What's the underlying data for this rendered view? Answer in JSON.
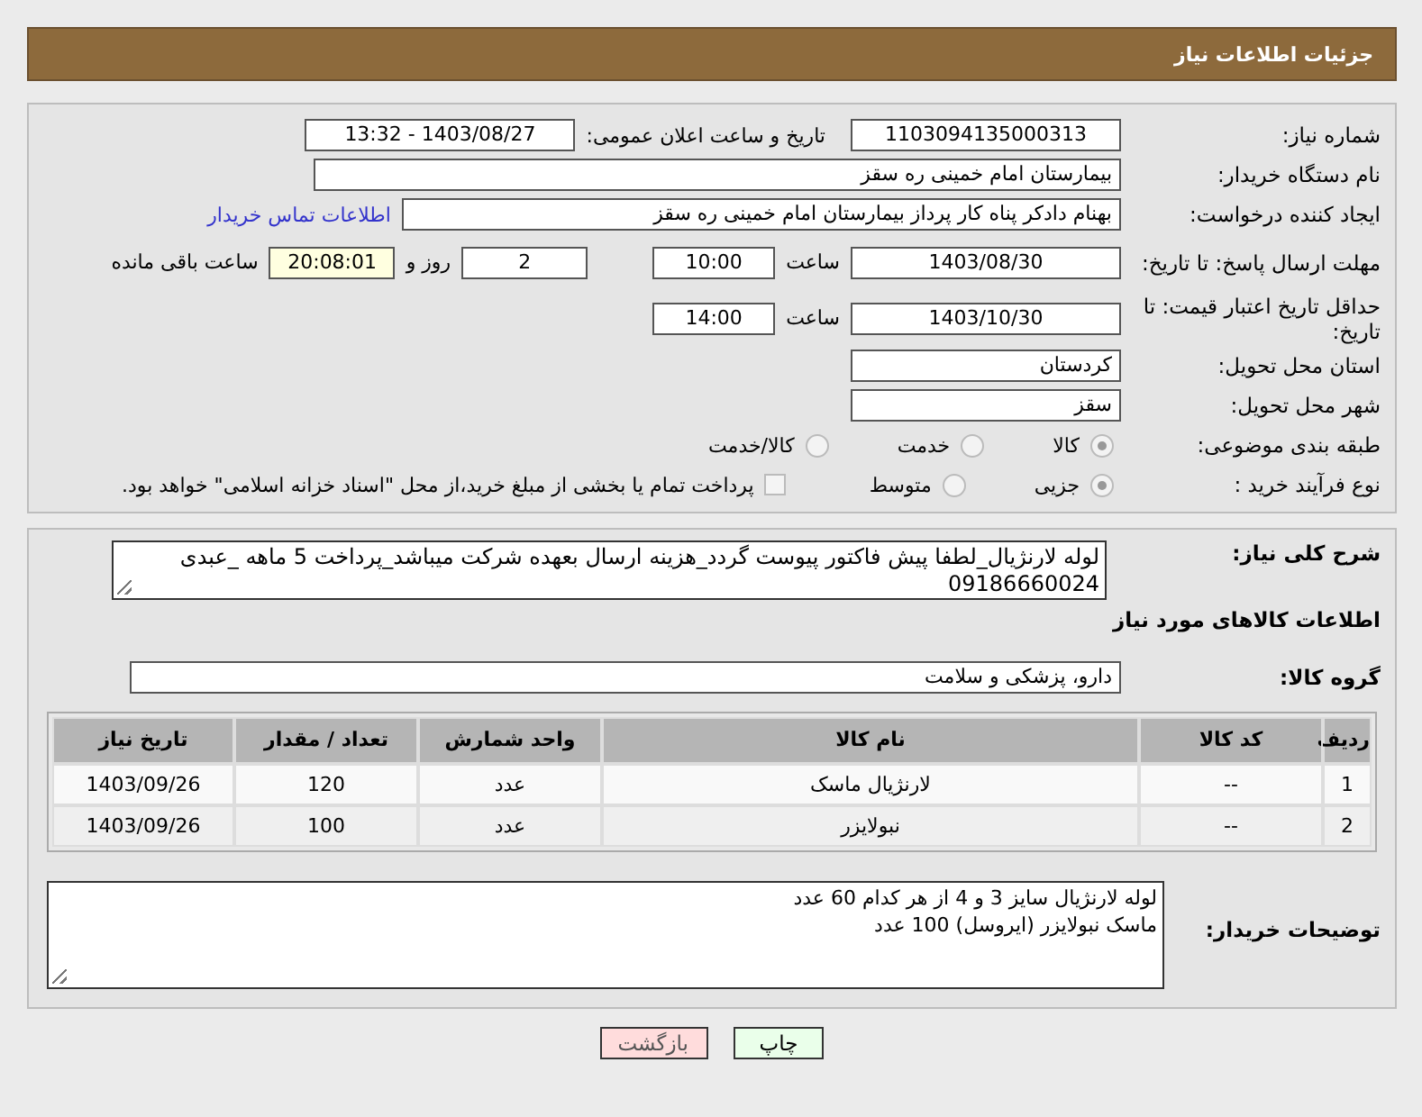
{
  "header": {
    "title": "جزئیات اطلاعات نیاز"
  },
  "need_number": {
    "label": "شماره نیاز:",
    "value": "1103094135000313"
  },
  "announce": {
    "label": "تاریخ و ساعت اعلان عمومی:",
    "value": "1403/08/27 - 13:32"
  },
  "buyer_org": {
    "label": "نام دستگاه خریدار:",
    "value": "بیمارستان امام خمینی  ره  سقز"
  },
  "requester": {
    "label": "ایجاد کننده درخواست:",
    "value": "بهنام دادکر پناه کار پرداز بیمارستان امام خمینی  ره  سقز",
    "link": "اطلاعات تماس خریدار"
  },
  "reply_deadline": {
    "label": "مهلت ارسال پاسخ: تا تاریخ:",
    "date": "1403/08/30",
    "time_label": "ساعت",
    "time": "10:00",
    "days": "2",
    "days_label": "روز و",
    "remaining": "20:08:01",
    "remaining_label": "ساعت باقی مانده"
  },
  "price_validity": {
    "label": "حداقل تاریخ اعتبار قیمت: تا تاریخ:",
    "date": "1403/10/30",
    "time_label": "ساعت",
    "time": "14:00"
  },
  "province": {
    "label": "استان محل تحویل:",
    "value": "کردستان"
  },
  "city": {
    "label": "شهر محل تحویل:",
    "value": "سقز"
  },
  "category": {
    "label": "طبقه بندی موضوعی:",
    "options": [
      {
        "label": "کالا",
        "selected": true
      },
      {
        "label": "خدمت",
        "selected": false
      },
      {
        "label": "کالا/خدمت",
        "selected": false
      }
    ]
  },
  "process": {
    "label": "نوع فرآیند خرید :",
    "options": [
      {
        "label": "جزیی",
        "selected": true
      },
      {
        "label": "متوسط",
        "selected": false
      }
    ],
    "treasury": {
      "label": "پرداخت تمام یا بخشی از مبلغ خرید،از محل \"اسناد خزانه اسلامی\" خواهد بود.",
      "checked": false
    }
  },
  "description": {
    "label": "شرح کلی نیاز:",
    "value": "لوله لارنژیال_لطفا پیش فاکتور پیوست گردد_هزینه ارسال بعهده شرکت میباشد_پرداخت 5 ماهه _عبدی 09186660024"
  },
  "goods_title": "اطلاعات کالاهای مورد نیاز",
  "goods_group": {
    "label": "گروه کالا:",
    "value": "دارو، پزشکی و سلامت"
  },
  "table": {
    "columns": [
      "ردیف",
      "کد کالا",
      "نام کالا",
      "واحد شمارش",
      "تعداد / مقدار",
      "تاریخ نیاز"
    ],
    "rows": [
      [
        "1",
        "--",
        "لارنژیال ماسک",
        "عدد",
        "120",
        "1403/09/26"
      ],
      [
        "2",
        "--",
        "نبولایزر",
        "عدد",
        "100",
        "1403/09/26"
      ]
    ]
  },
  "buyer_notes": {
    "label": "توضیحات خریدار:",
    "lines": [
      "لوله لارنژیال  سایز 3 و 4 از هر کدام  60 عدد",
      "ماسک نبولایزر (ایروسل)  100 عدد"
    ]
  },
  "buttons": [
    {
      "label": "چاپ",
      "kind": "print"
    },
    {
      "label": "بازگشت",
      "kind": "back"
    }
  ]
}
